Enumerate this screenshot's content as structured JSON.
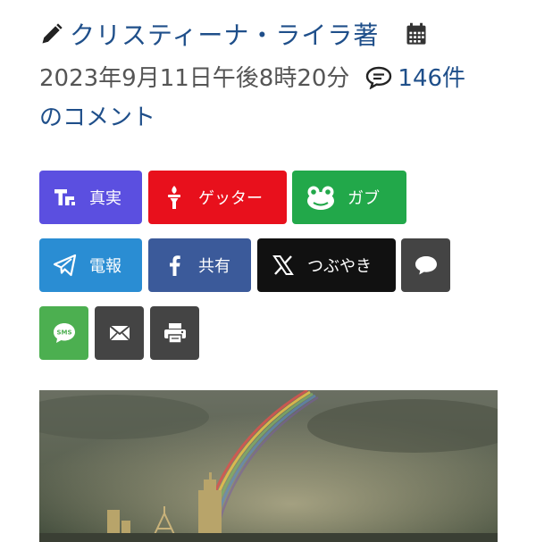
{
  "article": {
    "author": "クリスティーナ・ライラ著",
    "date": "2023年9月11日午後8時20分",
    "comments_count": "146件",
    "comments_suffix": "のコメント"
  },
  "share": {
    "buttons": [
      {
        "label": "真実",
        "color": "#5b4fe0"
      },
      {
        "label": "ゲッター",
        "color": "#e8101c"
      },
      {
        "label": "ガブ",
        "color": "#22a84a"
      },
      {
        "label": "電報",
        "color": "#2a8dd3"
      },
      {
        "label": "共有",
        "color": "#3b5a9a"
      },
      {
        "label": "つぶやき",
        "color": "#111111"
      }
    ],
    "icon_buttons": [
      {
        "icon": "chat-bubble-icon",
        "color": "#444444"
      },
      {
        "icon": "sms-icon",
        "color": "#4caf50"
      },
      {
        "icon": "email-icon",
        "color": "#444444"
      },
      {
        "icon": "print-icon",
        "color": "#444444"
      }
    ],
    "sms_text": "SMS"
  },
  "media": {
    "image": "rainbow-over-city-skyline"
  }
}
